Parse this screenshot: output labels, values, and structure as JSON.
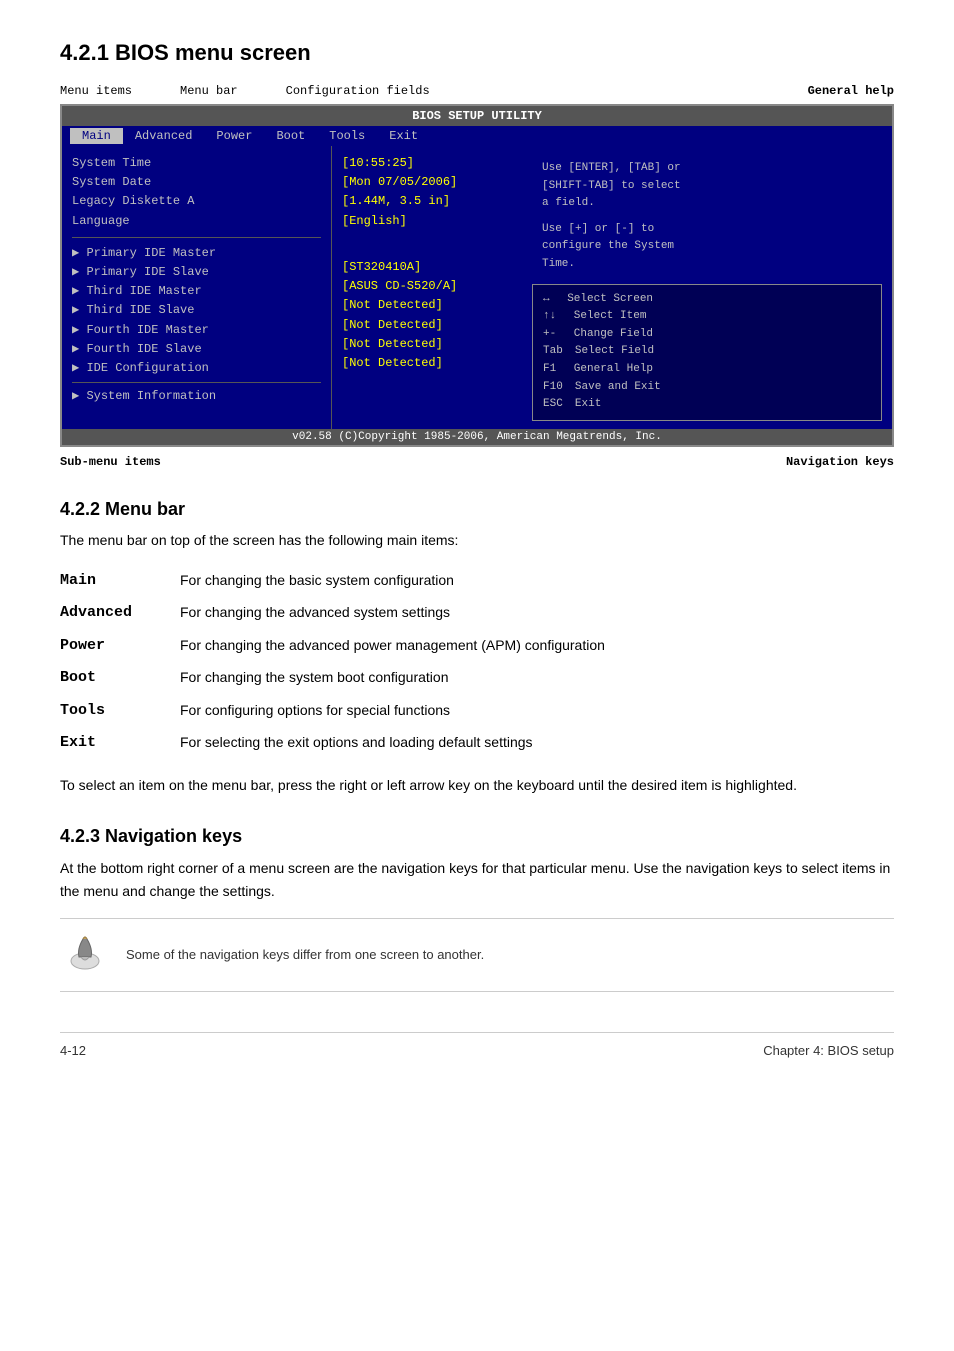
{
  "section421": {
    "heading": "4.2.1   BIOS menu screen",
    "labels": {
      "menu_items": "Menu items",
      "menu_bar": "Menu bar",
      "config_fields": "Configuration fields",
      "general_help": "General help",
      "sub_menu_items": "Sub-menu items",
      "navigation_keys": "Navigation keys"
    },
    "bios": {
      "title": "BIOS SETUP UTILITY",
      "menu_items": [
        "Main",
        "Advanced",
        "Power",
        "Boot",
        "Tools",
        "Exit"
      ],
      "active_menu": "Main",
      "left_items": [
        "System Time",
        "System Date",
        "Legacy Diskette A",
        "Language"
      ],
      "sub_items": [
        "Primary IDE Master",
        "Primary IDE Slave",
        "Third IDE Master",
        "Third IDE Slave",
        "Fourth IDE Master",
        "Fourth IDE Slave",
        "IDE Configuration"
      ],
      "system_info": "System Information",
      "center_items": [
        "[10:55:25]",
        "[Mon 07/05/2006]",
        "[1.44M, 3.5 in]",
        "[English]",
        "",
        "[ST320410A]",
        "[ASUS CD-S520/A]",
        "[Not Detected]",
        "[Not Detected]",
        "[Not Detected]",
        "[Not Detected]"
      ],
      "help_text": [
        "Use [ENTER], [TAB] or",
        "[SHIFT-TAB] to select",
        "a field.",
        "",
        "Use [+] or [-] to",
        "configure the System",
        "Time."
      ],
      "nav_keys": [
        "↔    Select Screen",
        "↑↓    Select Item",
        "+-   Change Field",
        "Tab  Select Field",
        "F1   General Help",
        "F10  Save and Exit",
        "ESC  Exit"
      ],
      "footer": "v02.58 (C)Copyright 1985-2006, American Megatrends, Inc."
    }
  },
  "section422": {
    "heading": "4.2.2   Menu bar",
    "intro": "The menu bar on top of the screen has the following main items:",
    "items": [
      {
        "key": "Main",
        "desc": "For changing the basic system configuration"
      },
      {
        "key": "Advanced",
        "desc": "For changing the advanced system settings"
      },
      {
        "key": "Power",
        "desc": "For changing the advanced power management (APM) configuration"
      },
      {
        "key": "Boot",
        "desc": "For changing the system boot configuration"
      },
      {
        "key": "Tools",
        "desc": "For configuring options for special functions"
      },
      {
        "key": "Exit",
        "desc": "For selecting the exit options and loading default settings"
      }
    ],
    "outro": "To select an item on the menu bar, press the right or left arrow key on the keyboard until the desired item is highlighted."
  },
  "section423": {
    "heading": "4.2.3   Navigation keys",
    "para1": "At the bottom right corner of a menu screen are the navigation keys for that particular menu. Use the navigation keys to select items in the menu and change the settings.",
    "note": "Some of the navigation keys differ from one screen to another."
  },
  "footer": {
    "left": "4-12",
    "right": "Chapter 4: BIOS setup"
  }
}
